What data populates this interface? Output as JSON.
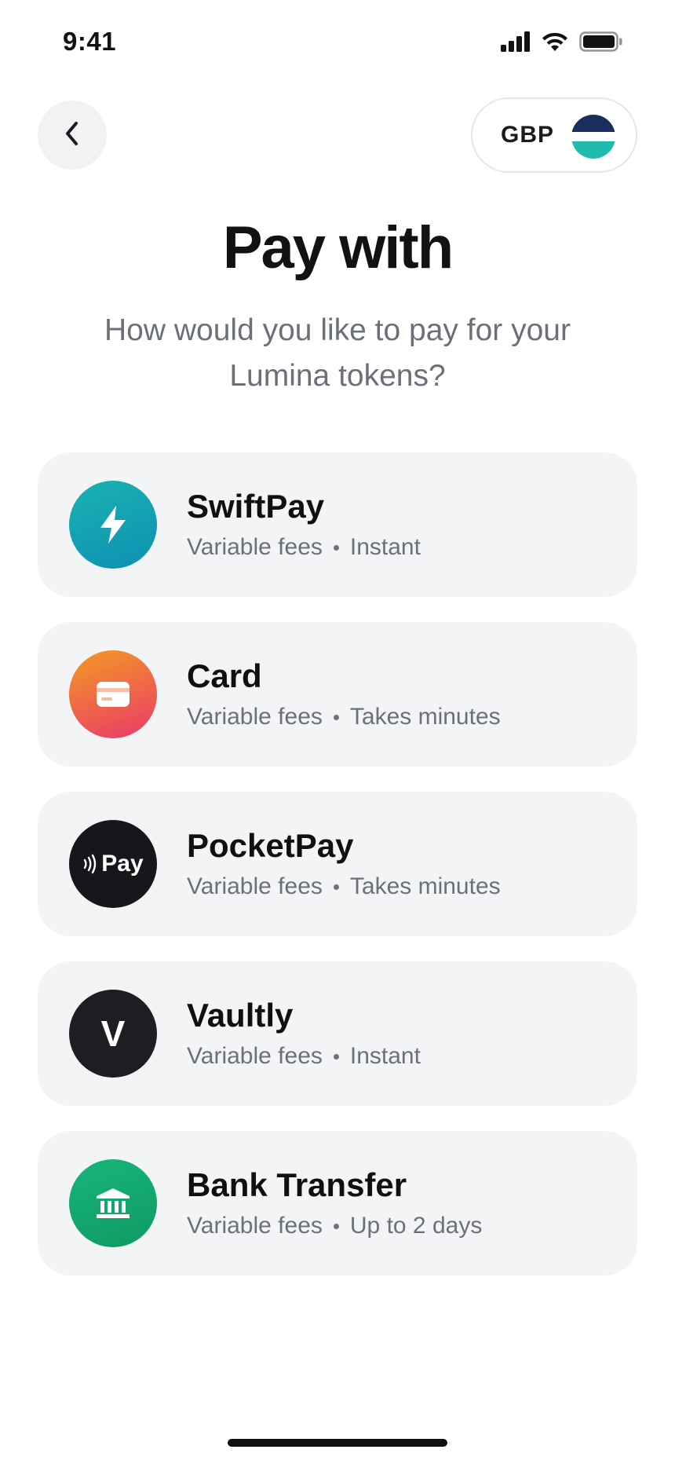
{
  "status_bar": {
    "time": "9:41",
    "icons": [
      "signal-icon",
      "wifi-icon",
      "battery-icon"
    ]
  },
  "header": {
    "back_icon": "chevron-left-icon",
    "currency": {
      "code": "GBP",
      "flag_colors": [
        "#1b2f5e",
        "#ffffff",
        "#1fbcae"
      ]
    }
  },
  "title": "Pay with",
  "subtitle": "How would you like to pay for your Lumina tokens?",
  "payment_methods": [
    {
      "name": "SwiftPay",
      "fees": "Variable fees",
      "timing": "Instant",
      "icon": "lightning-icon",
      "color": "#14a3b4"
    },
    {
      "name": "Card",
      "fees": "Variable fees",
      "timing": "Takes minutes",
      "icon": "credit-card-icon",
      "color": "#ef6a47"
    },
    {
      "name": "PocketPay",
      "fees": "Variable fees",
      "timing": "Takes minutes",
      "icon": "contactless-pay-icon",
      "icon_label": "Pay",
      "color": "#16171a"
    },
    {
      "name": "Vaultly",
      "fees": "Variable fees",
      "timing": "Instant",
      "icon": "letter-v-icon",
      "icon_label": "V",
      "color": "#1d1e21"
    },
    {
      "name": "Bank Transfer",
      "fees": "Variable fees",
      "timing": "Up to 2 days",
      "icon": "bank-icon",
      "color": "#14a96f"
    }
  ],
  "colors": {
    "card_background": "#f3f4f6",
    "secondary_text": "#6b7079",
    "primary_text": "#111214"
  }
}
